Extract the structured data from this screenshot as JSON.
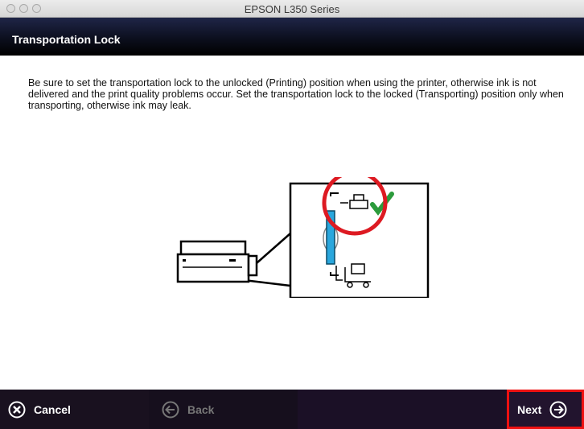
{
  "window": {
    "title": "EPSON L350 Series"
  },
  "header": {
    "title": "Transportation Lock"
  },
  "content": {
    "instructions": "Be sure to set the transportation lock to the unlocked (Printing) position when using the printer, otherwise ink is not delivered and the print quality problems occur. Set the transportation lock to the locked (Transporting) position only when transporting, otherwise ink may leak.",
    "illustration_icons": [
      "printer-icon",
      "check-icon",
      "cart-icon",
      "lock-lever"
    ],
    "colors": {
      "highlight_circle": "#dd1a22",
      "lever": "#2aa7dd",
      "check": "#2c9b3c"
    }
  },
  "footer": {
    "cancel_label": "Cancel",
    "back_label": "Back",
    "next_label": "Next",
    "colors": {
      "next_border": "#e11111"
    }
  }
}
